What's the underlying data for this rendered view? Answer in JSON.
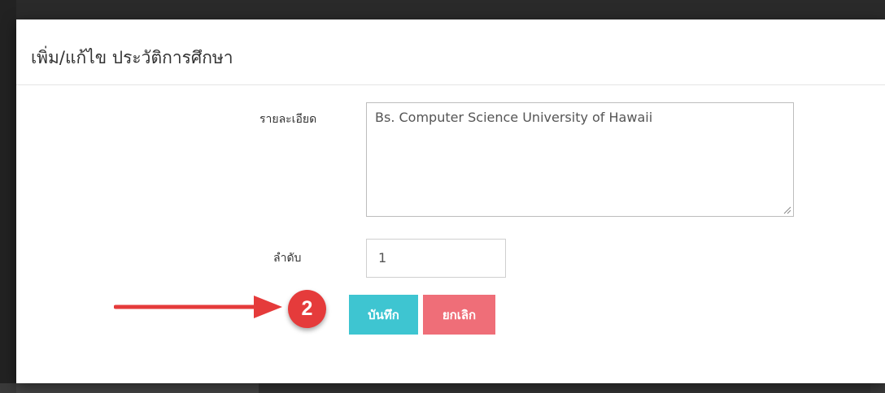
{
  "modal": {
    "title": "เพิ่ม/แก้ไข ประวัติการศึกษา"
  },
  "form": {
    "detail_label": "รายละเอียด",
    "detail_value": "Bs. Computer Science University of Hawaii",
    "order_label": "ลำดับ",
    "order_value": "1"
  },
  "buttons": {
    "save_label": "บันทึก",
    "cancel_label": "ยกเลิก"
  },
  "annotation": {
    "step_number": "2",
    "arrow_color": "#e53b3b"
  },
  "colors": {
    "save": "#3ec5d1",
    "cancel": "#ef6e78"
  }
}
